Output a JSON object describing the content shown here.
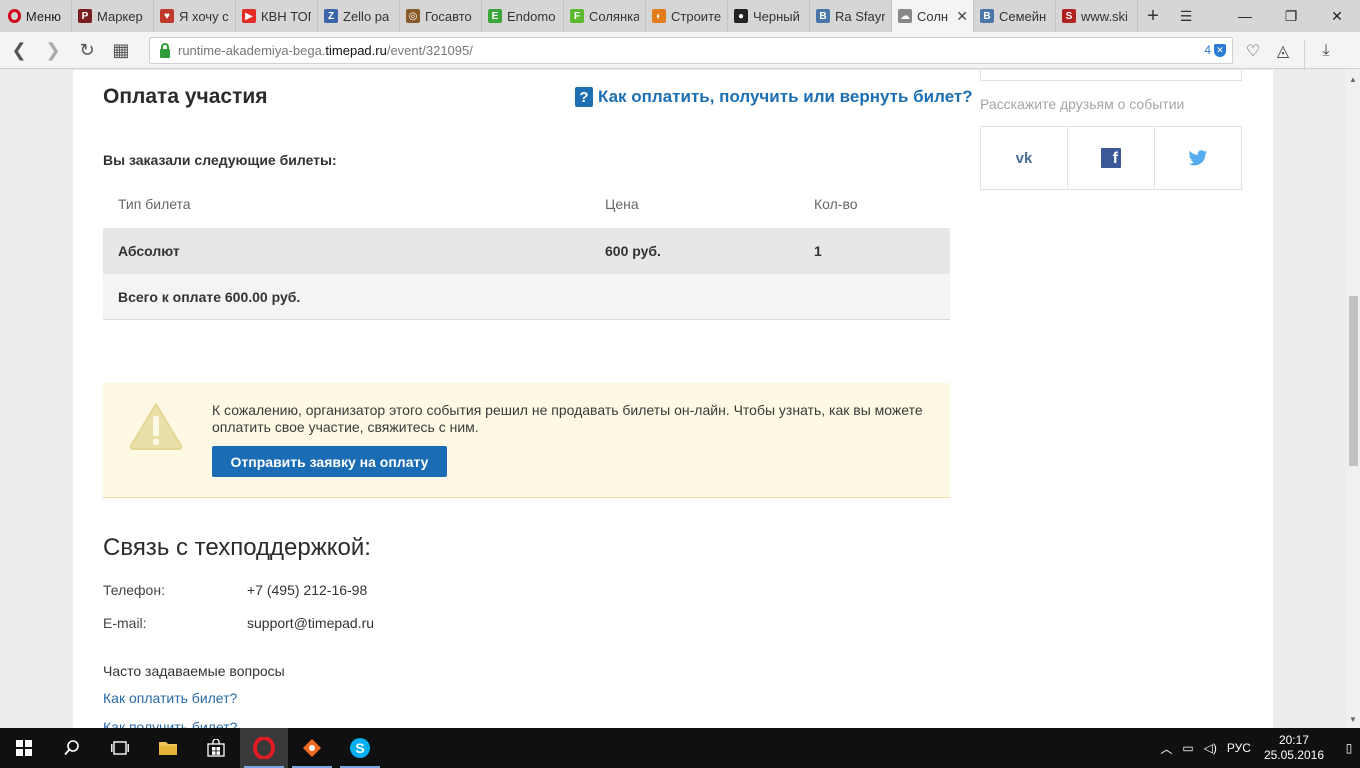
{
  "browser": {
    "menu_label": "Меню",
    "tabs": [
      {
        "label": "Маркер",
        "fav": "P",
        "color": "#7a1f1f"
      },
      {
        "label": "Я хочу се",
        "fav": "♥",
        "color": "#c0392b"
      },
      {
        "label": "КВН ТОП",
        "fav": "▶",
        "color": "#e52d27"
      },
      {
        "label": "Zello ра",
        "fav": "Z",
        "color": "#3a66a8"
      },
      {
        "label": "Госавто",
        "fav": "◎",
        "color": "#8b5a2b"
      },
      {
        "label": "Endomo",
        "fav": "E",
        "color": "#3aa63a"
      },
      {
        "label": "Солянка",
        "fav": "F",
        "color": "#5cb82f"
      },
      {
        "label": "Строите",
        "fav": "◐",
        "color": "#e37d1b"
      },
      {
        "label": "Черный",
        "fav": "●",
        "color": "#222222"
      },
      {
        "label": "Ra Sfayra",
        "fav": "B",
        "color": "#4a76a8"
      },
      {
        "label": "Солн",
        "fav": "☁",
        "color": "#888888",
        "active": true
      },
      {
        "label": "Семейн",
        "fav": "B",
        "color": "#4a76a8"
      },
      {
        "label": "www.ski",
        "fav": "S",
        "color": "#b02020"
      }
    ],
    "url_prefix": "runtime-akademiya-bega.",
    "url_host": "timepad.ru",
    "url_path": "/event/321095/",
    "adblock_count": "4"
  },
  "main": {
    "title": "Оплата участия",
    "help_link": "Как оплатить, получить или вернуть билет?",
    "ordered_label": "Вы заказали следующие билеты:",
    "table": {
      "headers": [
        "Тип билета",
        "Цена",
        "Кол-во"
      ],
      "rows": [
        {
          "type": "Абсолют",
          "price": "600 руб.",
          "qty": "1"
        }
      ],
      "total": "Всего к оплате 600.00 руб."
    },
    "notice": {
      "text": "К сожалению, организатор этого события решил не продавать билеты он-лайн. Чтобы узнать, как вы можете оплатить свое участие, свяжитесь с ним.",
      "button": "Отправить заявку на оплату"
    },
    "support": {
      "title": "Связь с техподдержкой:",
      "phone_label": "Телефон:",
      "phone": "+7 (495) 212-16-98",
      "email_label": "E-mail:",
      "email": "support@timepad.ru"
    },
    "faq": {
      "title": "Часто задаваемые вопросы",
      "links": [
        "Как оплатить билет?",
        "Как получить билет?"
      ]
    }
  },
  "sidebar": {
    "share_label": "Расскажите друзьям о событии",
    "share_buttons": [
      "vk",
      "facebook",
      "twitter"
    ]
  },
  "taskbar": {
    "lang": "РУС",
    "time": "20:17",
    "date": "25.05.2016"
  }
}
